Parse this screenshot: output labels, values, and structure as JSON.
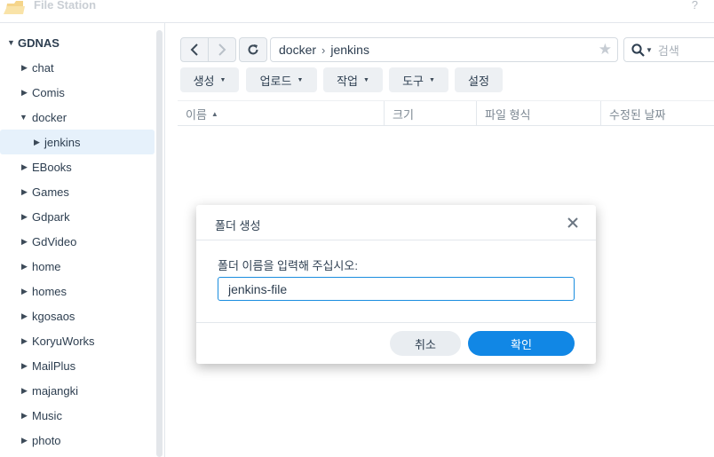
{
  "app": {
    "title": "File Station",
    "help": "?"
  },
  "sidebar": {
    "root": "GDNAS",
    "items": [
      {
        "label": "chat"
      },
      {
        "label": "Comis"
      },
      {
        "label": "docker"
      },
      {
        "label": "jenkins"
      },
      {
        "label": "EBooks"
      },
      {
        "label": "Games"
      },
      {
        "label": "Gdpark"
      },
      {
        "label": "GdVideo"
      },
      {
        "label": "home"
      },
      {
        "label": "homes"
      },
      {
        "label": "kgosaos"
      },
      {
        "label": "KoryuWorks"
      },
      {
        "label": "MailPlus"
      },
      {
        "label": "majangki"
      },
      {
        "label": "Music"
      },
      {
        "label": "photo"
      }
    ]
  },
  "toolbar": {
    "path": [
      "docker",
      "jenkins"
    ],
    "search_placeholder": "검색",
    "actions": [
      {
        "label": "생성"
      },
      {
        "label": "업로드"
      },
      {
        "label": "작업"
      },
      {
        "label": "도구"
      },
      {
        "label": "설정"
      }
    ]
  },
  "table": {
    "columns": [
      "이름",
      "크기",
      "파일 형식",
      "수정된 날짜"
    ]
  },
  "dialog": {
    "title": "폴더 생성",
    "prompt": "폴더 이름을 입력해 주십시오:",
    "input_value": "jenkins-file",
    "cancel": "취소",
    "ok": "확인"
  },
  "colors": {
    "accent": "#1187e5",
    "selected_bg": "#e6f1fb"
  }
}
